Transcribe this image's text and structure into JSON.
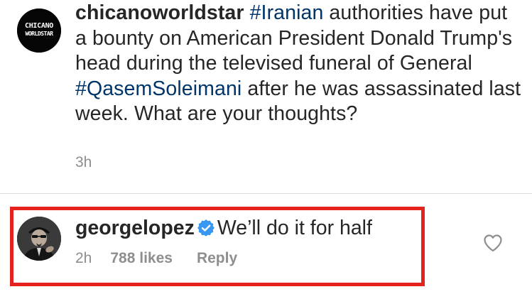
{
  "post": {
    "avatar_logo": {
      "line1": "CHICANO",
      "line2": "WORLDSTAR"
    },
    "username": "chicanoworldstar",
    "caption_segments": [
      {
        "type": "hashtag",
        "text": "#Iranian"
      },
      {
        "type": "text",
        "text": " authorities have put a bounty on American President Donald Trump's head during the televised funeral of General "
      },
      {
        "type": "hashtag",
        "text": "#QasemSoleimani"
      },
      {
        "type": "text",
        "text": " after he was assassinated last week. What are your thoughts?"
      }
    ],
    "time": "3h"
  },
  "comment": {
    "username": "georgelopez",
    "verified": true,
    "text": "We’ll do it for half",
    "time": "2h",
    "likes": "788 likes",
    "reply_label": "Reply",
    "like_icon": "heart-outline-icon"
  },
  "colors": {
    "text": "#262626",
    "hashtag": "#003569",
    "muted": "#8e8e8e",
    "verified_blue": "#3897f0",
    "highlight_red": "#e4231f",
    "divider": "#dbdbdb"
  }
}
